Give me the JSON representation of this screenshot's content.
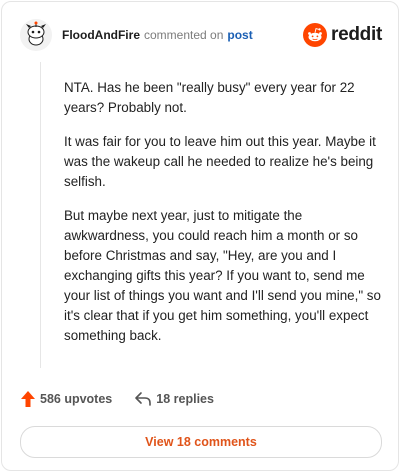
{
  "header": {
    "username": "FloodAndFire",
    "action": "commented on",
    "target": "post",
    "brand": "reddit"
  },
  "comment": {
    "paragraphs": [
      "NTA. Has he been \"really busy\" every year for 22 years? Probably not.",
      "It was fair for you to leave him out this year. Maybe it was the wakeup call he needed to realize he's being selfish.",
      "But maybe next year, just to mitigate the awkwardness, you could reach him a month or so before Christmas and say, \"Hey, are you and I exchanging gifts this year? If you want to, send me your list of things you want and I'll send you mine,\" so it's clear that if you get him something, you'll expect something back."
    ]
  },
  "footer": {
    "upvotes": "586 upvotes",
    "replies": "18 replies",
    "view_comments": "View 18 comments"
  },
  "colors": {
    "brand": "#ff4500",
    "link": "#1a5fb4",
    "upvote": "#ff4500",
    "view_button_text": "#e0541a"
  },
  "icons": {
    "avatar": "snoo-avatar-icon",
    "brand": "reddit-logo-icon",
    "upvote": "upvote-arrow-icon",
    "reply": "reply-arrow-icon"
  }
}
